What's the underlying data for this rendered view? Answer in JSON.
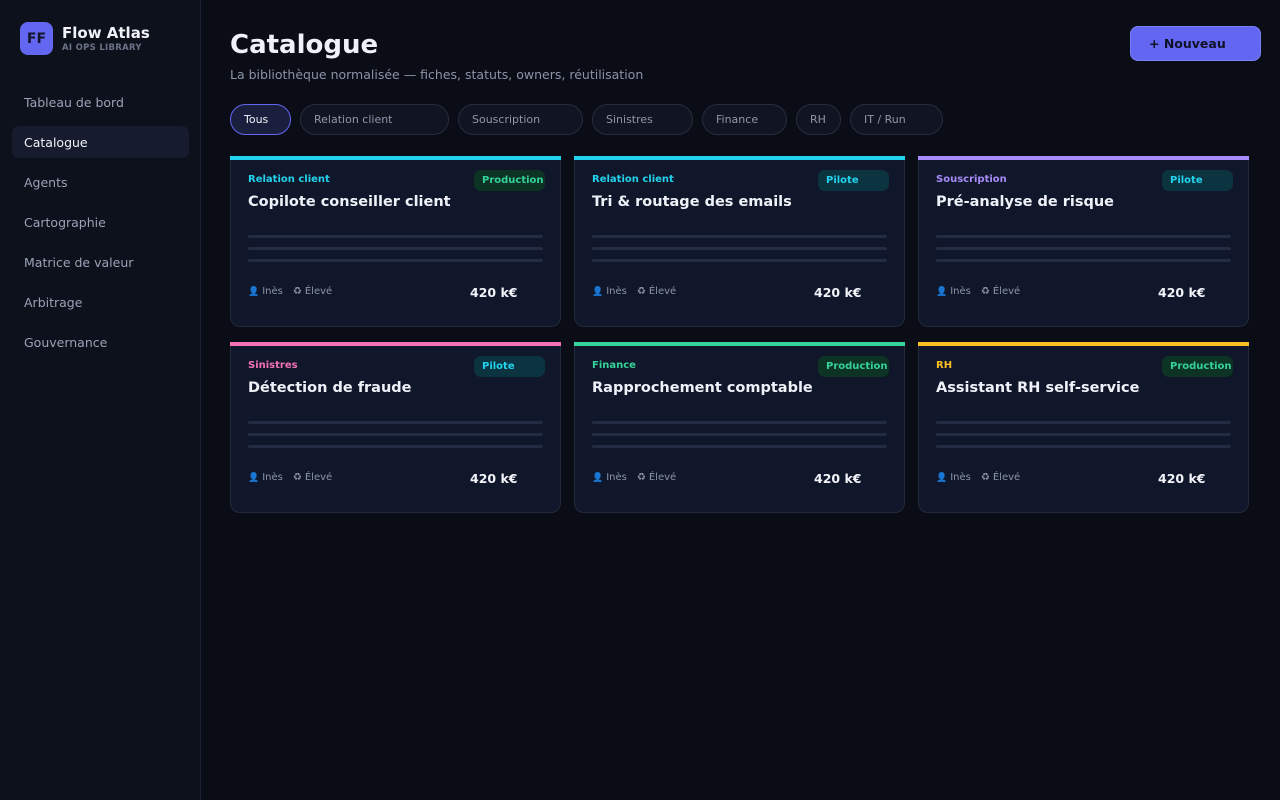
{
  "brand": {
    "logo": "FF",
    "name": "Flow Atlas",
    "subtitle": "AI OPS LIBRARY"
  },
  "nav": [
    {
      "label": "Tableau de bord",
      "active": false
    },
    {
      "label": "Catalogue",
      "active": true
    },
    {
      "label": "Agents",
      "active": false
    },
    {
      "label": "Cartographie",
      "active": false
    },
    {
      "label": "Matrice de valeur",
      "active": false
    },
    {
      "label": "Arbitrage",
      "active": false
    },
    {
      "label": "Gouvernance",
      "active": false
    }
  ],
  "header": {
    "title": "Catalogue",
    "subtitle": "La bibliothèque normalisée — fiches, statuts, owners, réutilisation",
    "new_button": "+ Nouveau"
  },
  "filters": [
    {
      "label": "Tous",
      "active": true
    },
    {
      "label": "Relation client",
      "active": false
    },
    {
      "label": "Souscription",
      "active": false
    },
    {
      "label": "Sinistres",
      "active": false
    },
    {
      "label": "Finance",
      "active": false
    },
    {
      "label": "RH",
      "active": false
    },
    {
      "label": "IT / Run",
      "active": false
    }
  ],
  "cards": [
    {
      "category": "Relation client",
      "category_color": "#22d3ee",
      "status": "Production",
      "title": "Copilote conseiller client",
      "owner_icon": "person-icon",
      "owner": "Inès",
      "reuse_icon": "recycle-icon",
      "reuse": "Élevé",
      "budget": "420 k€"
    },
    {
      "category": "Relation client",
      "category_color": "#22d3ee",
      "status": "Pilote",
      "title": "Tri & routage des emails",
      "owner_icon": "person-icon",
      "owner": "Inès",
      "reuse_icon": "recycle-icon",
      "reuse": "Élevé",
      "budget": "420 k€"
    },
    {
      "category": "Souscription",
      "category_color": "#a78bfa",
      "status": "Pilote",
      "title": "Pré-analyse de risque",
      "owner_icon": "person-icon",
      "owner": "Inès",
      "reuse_icon": "recycle-icon",
      "reuse": "Élevé",
      "budget": "420 k€"
    },
    {
      "category": "Sinistres",
      "category_color": "#f472b6",
      "status": "Pilote",
      "title": "Détection de fraude",
      "owner_icon": "person-icon",
      "owner": "Inès",
      "reuse_icon": "recycle-icon",
      "reuse": "Élevé",
      "budget": "420 k€"
    },
    {
      "category": "Finance",
      "category_color": "#34d399",
      "status": "Production",
      "title": "Rapprochement comptable",
      "owner_icon": "person-icon",
      "owner": "Inès",
      "reuse_icon": "recycle-icon",
      "reuse": "Élevé",
      "budget": "420 k€"
    },
    {
      "category": "RH",
      "category_color": "#fbbf24",
      "status": "Production",
      "title": "Assistant RH self-service",
      "owner_icon": "person-icon",
      "owner": "Inès",
      "reuse_icon": "recycle-icon",
      "reuse": "Élevé",
      "budget": "420 k€"
    }
  ]
}
